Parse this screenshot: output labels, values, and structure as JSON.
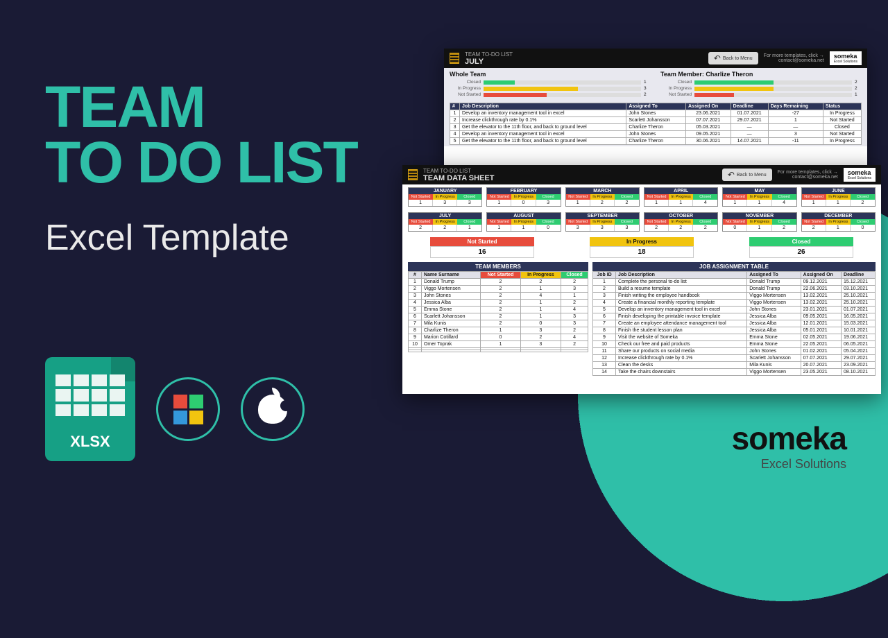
{
  "hero": {
    "title_line1": "TEAM",
    "title_line2": "TO DO LIST",
    "subtitle": "Excel Template",
    "xlsx_label": "XLSX"
  },
  "brand": {
    "name": "someka",
    "tagline": "Excel Solutions"
  },
  "shot_back": {
    "breadcrumb": "TEAM TO-DO LIST",
    "page_title": "JULY",
    "back_label": "Back to Menu",
    "more_label": "For more templates, click →",
    "contact": "contact@someka.net",
    "whole_team_label": "Whole Team",
    "team_member_label": "Team Member:",
    "team_member_name": "Charlize Theron",
    "status_labels": {
      "closed": "Closed",
      "inprog": "In Progress",
      "notstarted": "Not Started"
    },
    "whole_team_stats": {
      "closed": 1,
      "inprog": 3,
      "notstarted": 2
    },
    "member_stats": {
      "closed": 2,
      "inprog": 2,
      "notstarted": 1
    },
    "table_headers": [
      "#",
      "Job Description",
      "Assigned To",
      "Assigned On",
      "Deadline",
      "Days Remaining",
      "Status"
    ],
    "rows": [
      [
        "1",
        "Develop an inventory management tool in excel",
        "John Stones",
        "23.06.2021",
        "01.07.2021",
        "-27",
        "In Progress"
      ],
      [
        "2",
        "Increase clickthrough rate by 0.1%",
        "Scarlett Johansson",
        "07.07.2021",
        "29.07.2021",
        "1",
        "Not Started"
      ],
      [
        "3",
        "Get the elevator to the 11th floor, and back to ground level",
        "Charlize Theron",
        "05.03.2021",
        "—",
        "—",
        "Closed"
      ],
      [
        "4",
        "Develop an inventory management tool in excel",
        "John Stones",
        "09.05.2021",
        "—",
        "3",
        "Not Started"
      ],
      [
        "5",
        "Get the elevator to the 11th floor, and back to ground level",
        "Charlize Theron",
        "30.06.2021",
        "14.07.2021",
        "-11",
        "In Progress"
      ]
    ]
  },
  "shot_front": {
    "breadcrumb": "TEAM TO-DO LIST",
    "page_title": "TEAM DATA SHEET",
    "back_label": "Back to Menu",
    "more_label": "For more templates, click →",
    "contact": "contact@someka.net",
    "status_labels": {
      "ns": "Not Started",
      "ip": "In Progress",
      "cl": "Closed"
    },
    "months": [
      {
        "name": "JANUARY",
        "ns": 1,
        "ip": 3,
        "cl": 3
      },
      {
        "name": "FEBRUARY",
        "ns": 1,
        "ip": 0,
        "cl": 3
      },
      {
        "name": "MARCH",
        "ns": 1,
        "ip": 2,
        "cl": 2
      },
      {
        "name": "APRIL",
        "ns": 1,
        "ip": 1,
        "cl": 4
      },
      {
        "name": "MAY",
        "ns": 1,
        "ip": 1,
        "cl": 4
      },
      {
        "name": "JUNE",
        "ns": 1,
        "ip": 1,
        "cl": 2
      },
      {
        "name": "JULY",
        "ns": 2,
        "ip": 2,
        "cl": 1
      },
      {
        "name": "AUGUST",
        "ns": 1,
        "ip": 1,
        "cl": 0
      },
      {
        "name": "SEPTEMBER",
        "ns": 3,
        "ip": 3,
        "cl": 3
      },
      {
        "name": "OCTOBER",
        "ns": 2,
        "ip": 2,
        "cl": 2
      },
      {
        "name": "NOVEMBER",
        "ns": 0,
        "ip": 1,
        "cl": 2
      },
      {
        "name": "DECEMBER",
        "ns": 2,
        "ip": 1,
        "cl": 0
      }
    ],
    "totals": {
      "ns_label": "Not Started",
      "ns": 16,
      "ip_label": "In Progress",
      "ip": 18,
      "cl_label": "Closed",
      "cl": 26
    },
    "team_table": {
      "title": "TEAM MEMBERS",
      "headers": [
        "#",
        "Name Surname",
        "Not Started",
        "In Progress",
        "Closed"
      ],
      "rows": [
        [
          "1",
          "Donald Trump",
          "2",
          "2",
          "2"
        ],
        [
          "2",
          "Viggo Mortensen",
          "2",
          "1",
          "3"
        ],
        [
          "3",
          "John Stones",
          "2",
          "4",
          "1"
        ],
        [
          "4",
          "Jessica Alba",
          "2",
          "1",
          "2"
        ],
        [
          "5",
          "Emma Stone",
          "2",
          "1",
          "4"
        ],
        [
          "6",
          "Scarlett Johansson",
          "2",
          "1",
          "3"
        ],
        [
          "7",
          "Mila Kunis",
          "2",
          "0",
          "3"
        ],
        [
          "8",
          "Charlize Theron",
          "1",
          "3",
          "2"
        ],
        [
          "9",
          "Marion Cotillard",
          "0",
          "2",
          "4"
        ],
        [
          "10",
          "Omer Toprak",
          "1",
          "3",
          "2"
        ],
        [
          "",
          "",
          "",
          "",
          ""
        ],
        [
          "",
          "",
          "",
          "",
          ""
        ]
      ]
    },
    "job_table": {
      "title": "JOB ASSIGNMENT TABLE",
      "headers": [
        "Job ID",
        "Job Description",
        "Assigned To",
        "Assigned On",
        "Deadline"
      ],
      "rows": [
        [
          "1",
          "Complete the personal to-do list",
          "Donald Trump",
          "09.12.2021",
          "15.12.2021"
        ],
        [
          "2",
          "Build a resume template",
          "Donald Trump",
          "22.06.2021",
          "03.10.2021"
        ],
        [
          "3",
          "Finish writing the employee handbook",
          "Viggo Mortensen",
          "13.02.2021",
          "25.10.2021"
        ],
        [
          "4",
          "Create a financial monthly reporting template",
          "Viggo Mortensen",
          "13.02.2021",
          "25.10.2021"
        ],
        [
          "5",
          "Develop an inventory management tool in excel",
          "John Stones",
          "23.01.2021",
          "01.07.2021"
        ],
        [
          "6",
          "Finish developing the printable invoice template",
          "Jessica Alba",
          "09.05.2021",
          "16.05.2021"
        ],
        [
          "7",
          "Create an employee attendance management tool",
          "Jessica Alba",
          "12.01.2021",
          "15.03.2021"
        ],
        [
          "8",
          "Finish the student lesson plan",
          "Jessica Alba",
          "05.01.2021",
          "10.01.2021"
        ],
        [
          "9",
          "Visit the website of Someka",
          "Emma Stone",
          "02.05.2021",
          "19.06.2021"
        ],
        [
          "10",
          "Check our free and paid products",
          "Emma Stone",
          "22.05.2021",
          "06.05.2021"
        ],
        [
          "11",
          "Share our products on social media",
          "John Stones",
          "01.02.2021",
          "05.04.2021"
        ],
        [
          "12",
          "Increase clickthrough rate by 0.1%",
          "Scarlett Johansson",
          "07.07.2021",
          "29.07.2021"
        ],
        [
          "13",
          "Clean the desks",
          "Mila Kunis",
          "20.07.2021",
          "23.09.2021"
        ],
        [
          "14",
          "Take the chairs downstairs",
          "Viggo Mortensen",
          "23.05.2021",
          "08.10.2021"
        ]
      ]
    }
  }
}
